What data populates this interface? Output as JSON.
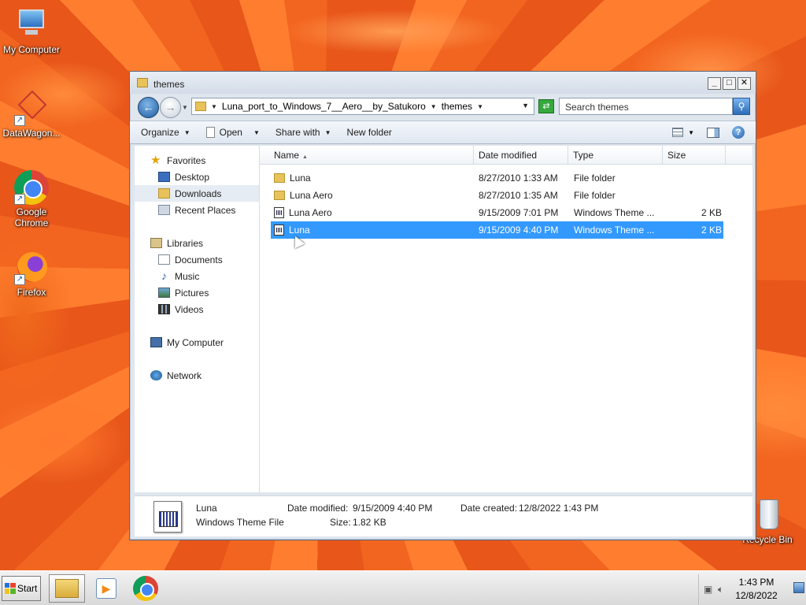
{
  "desktop": {
    "icons": [
      {
        "label": "My Computer"
      },
      {
        "label": "DataWagon..."
      },
      {
        "label": "Google Chrome"
      },
      {
        "label": "Firefox"
      },
      {
        "label": "Recycle Bin"
      }
    ]
  },
  "window": {
    "title": "themes",
    "controls": {
      "minimize": "_",
      "maximize": "□",
      "close": "✕"
    }
  },
  "address": {
    "crumbs": [
      "Luna_port_to_Windows_7__Aero__by_Satukoro",
      "themes"
    ],
    "search_placeholder": "Search themes"
  },
  "toolbar": {
    "organize": "Organize",
    "open": "Open",
    "share_with": "Share with",
    "new_folder": "New folder"
  },
  "nav": {
    "favorites": "Favorites",
    "desktop": "Desktop",
    "downloads": "Downloads",
    "recent_places": "Recent Places",
    "libraries": "Libraries",
    "documents": "Documents",
    "music": "Music",
    "pictures": "Pictures",
    "videos": "Videos",
    "my_computer": "My Computer",
    "network": "Network"
  },
  "columns": {
    "name": "Name",
    "date_modified": "Date modified",
    "type": "Type",
    "size": "Size"
  },
  "files": [
    {
      "name": "Luna",
      "date": "8/27/2010 1:33 AM",
      "type": "File folder",
      "size": "",
      "icon": "folder-icon",
      "selected": false
    },
    {
      "name": "Luna Aero",
      "date": "8/27/2010 1:35 AM",
      "type": "File folder",
      "size": "",
      "icon": "folder-icon",
      "selected": false
    },
    {
      "name": "Luna Aero",
      "date": "9/15/2009 7:01 PM",
      "type": "Windows Theme ...",
      "size": "2 KB",
      "icon": "theme-file-icon",
      "selected": false
    },
    {
      "name": "Luna",
      "date": "9/15/2009 4:40 PM",
      "type": "Windows Theme ...",
      "size": "2 KB",
      "icon": "theme-file-icon",
      "selected": true
    }
  ],
  "details": {
    "name": "Luna",
    "type": "Windows Theme File",
    "date_modified_label": "Date modified:",
    "date_modified": "9/15/2009 4:40 PM",
    "date_created_label": "Date created:",
    "date_created": "12/8/2022 1:43 PM",
    "size_label": "Size:",
    "size": "1.82 KB"
  },
  "taskbar": {
    "start": "Start",
    "time": "1:43 PM",
    "date": "12/8/2022"
  }
}
